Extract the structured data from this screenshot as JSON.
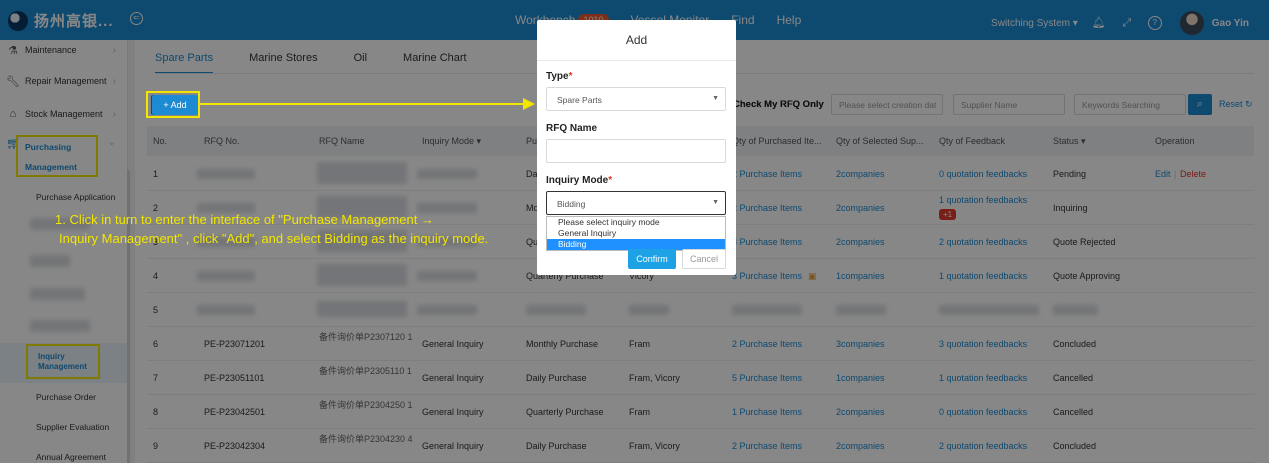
{
  "header": {
    "logo_text": "扬州高银...",
    "nav": [
      {
        "label": "Workbench",
        "badge": "1010"
      },
      {
        "label": "Vessel Monitor",
        "badge": ""
      },
      {
        "label": "Find",
        "badge": ""
      },
      {
        "label": "Help",
        "badge": ""
      }
    ],
    "switch_system": "Switching System ▾",
    "username": "Gao Yin"
  },
  "sidebar": {
    "maintenance": "Maintenance",
    "repair": "Repair Management",
    "stock": "Stock Management",
    "purchasing": "Purchasing Management",
    "sub_items": {
      "purchase_application": "Purchase Application",
      "inquiry_management": "Inquiry Management",
      "purchase_order": "Purchase Order",
      "supplier_evaluation": "Supplier Evaluation",
      "annual_agreement": "Annual Agreement"
    }
  },
  "tabs": [
    "Spare Parts",
    "Marine Stores",
    "Oil",
    "Marine Chart"
  ],
  "toolbar": {
    "add_label": "+ Add",
    "check_my_rfq": "Check My RFQ Only",
    "date_placeholder": "Please select creation dat",
    "supplier_placeholder": "Supplier Name",
    "keyword_placeholder": "Keywords Searching",
    "reset_label": "Reset"
  },
  "table": {
    "columns": [
      "No.",
      "RFQ No.",
      "RFQ Name",
      "Inquiry Mode ▾",
      "Pu",
      "Qty of Purchased Ite...",
      "Qty of Selected Sup...",
      "Qty of Feedback",
      "Status ▾",
      "Operation"
    ],
    "rows": [
      {
        "no": "1",
        "rfq_no": "",
        "rfq_name": "",
        "mode": "",
        "purchase": "Da",
        "supplier": "",
        "items": "2 Purchase Items",
        "companies": "2companies",
        "feedback": "0 quotation feedbacks",
        "feedback_badge": "",
        "status": "Pending",
        "edit": "Edit",
        "delete": "Delete"
      },
      {
        "no": "2",
        "rfq_no": "",
        "rfq_name": "",
        "mode": "",
        "purchase": "Mo",
        "supplier": "",
        "items": "2 Purchase Items",
        "companies": "2companies",
        "feedback": "1 quotation feedbacks",
        "feedback_badge": "+1",
        "status": "Inquiring",
        "edit": "",
        "delete": ""
      },
      {
        "no": "3",
        "rfq_no": "",
        "rfq_name": "",
        "mode": "",
        "purchase": "Qu",
        "supplier": "",
        "items": "3 Purchase Items",
        "companies": "2companies",
        "feedback": "2 quotation feedbacks",
        "feedback_badge": "",
        "status": "Quote Rejected",
        "edit": "",
        "delete": ""
      },
      {
        "no": "4",
        "rfq_no": "",
        "rfq_name": "",
        "mode": "",
        "purchase": "Quarterly Purchase",
        "supplier": "Vicory",
        "items": "3 Purchase Items",
        "companies": "1companies",
        "feedback": "1 quotation feedbacks",
        "feedback_badge": "",
        "status": "Quote Approving",
        "edit": "",
        "delete": ""
      },
      {
        "no": "5",
        "rfq_no": "",
        "rfq_name": "",
        "mode": "",
        "purchase": "",
        "supplier": "",
        "items": "",
        "companies": "",
        "feedback": "",
        "feedback_badge": "",
        "status": "",
        "edit": "",
        "delete": ""
      },
      {
        "no": "6",
        "rfq_no": "PE-P23071201",
        "rfq_name": "备件询价单P2307120 1",
        "mode": "General Inquiry",
        "purchase": "Monthly Purchase",
        "supplier": "Fram",
        "items": "2 Purchase Items",
        "companies": "3companies",
        "feedback": "3 quotation feedbacks",
        "feedback_badge": "",
        "status": "Concluded",
        "edit": "",
        "delete": ""
      },
      {
        "no": "7",
        "rfq_no": "PE-P23051101",
        "rfq_name": "备件询价单P2305110 1",
        "mode": "General Inquiry",
        "purchase": "Daily Purchase",
        "supplier": "Fram, Vicory",
        "items": "5 Purchase Items",
        "companies": "1companies",
        "feedback": "1 quotation feedbacks",
        "feedback_badge": "",
        "status": "Cancelled",
        "edit": "",
        "delete": ""
      },
      {
        "no": "8",
        "rfq_no": "PE-P23042501",
        "rfq_name": "备件询价单P2304250 1",
        "mode": "General Inquiry",
        "purchase": "Quarterly Purchase",
        "supplier": "Fram",
        "items": "1 Purchase Items",
        "companies": "2companies",
        "feedback": "0 quotation feedbacks",
        "feedback_badge": "",
        "status": "Cancelled",
        "edit": "",
        "delete": ""
      },
      {
        "no": "9",
        "rfq_no": "PE-P23042304",
        "rfq_name": "备件询价单P2304230 4",
        "mode": "General Inquiry",
        "purchase": "Daily Purchase",
        "supplier": "Fram, Vicory",
        "items": "2 Purchase Items",
        "companies": "2companies",
        "feedback": "2 quotation feedbacks",
        "feedback_badge": "",
        "status": "Concluded",
        "edit": "",
        "delete": ""
      }
    ]
  },
  "instruction": {
    "line1": "1. Click in turn to enter the interface of  \"Purchase Management →",
    "line2": "Inquiry Management\" , click \"Add\", and select Bidding as the inquiry mode."
  },
  "modal": {
    "title": "Add",
    "type_label": "Type",
    "type_value": "Spare Parts",
    "rfq_name_label": "RFQ Name",
    "rfq_name_value": "",
    "inquiry_mode_label": "Inquiry Mode",
    "inquiry_mode_value": "Bidding",
    "options": [
      "Please select inquiry mode",
      "General Inquiry",
      "Bidding"
    ],
    "selected_option": "Bidding",
    "confirm": "Confirm",
    "cancel": "Cancel"
  },
  "colors": {
    "header_bg": "#1c8bd3",
    "accent": "#1c8bd3",
    "highlight": "#f2e600",
    "badge": "#f05a28",
    "danger": "#e0332a"
  }
}
